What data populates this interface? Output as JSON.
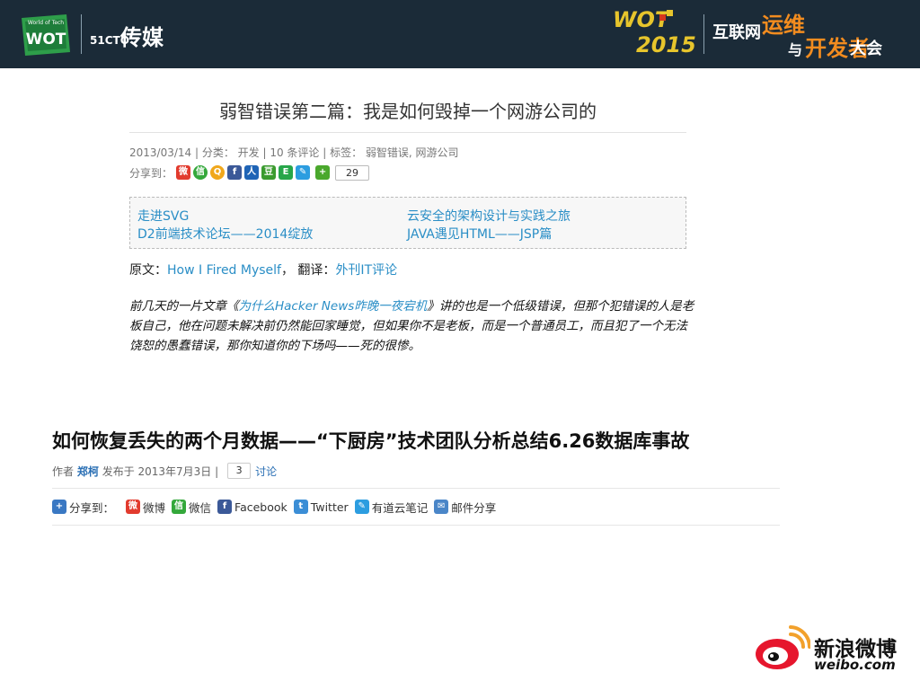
{
  "header": {
    "wot_logo_small": "World of Tech",
    "wot_logo_text": "WOT",
    "cto_brand": "51CTO",
    "media_brand": "传媒",
    "wot_line1": "WOT",
    "wot_line2": "2015",
    "conf_part1": "互联网",
    "conf_part2": "运维",
    "conf_part3": "与",
    "conf_part4": "开发者",
    "conf_part5": "大会"
  },
  "article1": {
    "title": "弱智错误第二篇：我是如何毁掉一个网游公司的",
    "meta": "2013/03/14 | 分类： 开发 | 10 条评论 | 标签： 弱智错误, 网游公司",
    "share_label": "分享到：",
    "share_count": "29",
    "related": [
      "走进SVG",
      "云安全的架构设计与实践之旅",
      "D2前端技术论坛——2014绽放",
      "JAVA遇见HTML——JSP篇"
    ],
    "source_label": "原文：",
    "source_link": "How I Fired Myself",
    "translate_label": "， 翻译：",
    "translate_link": "外刊IT评论",
    "intro_pre": "前几天的一片文章《",
    "intro_link": "为什么Hacker News昨晚一夜宕机",
    "intro_post": "》讲的也是一个低级错误，但那个犯错误的人是老板自己，他在问题未解决前仍然能回家睡觉，但如果你不是老板，而是一个普通员工，而且犯了一个无法饶恕的愚蠢错误，那你知道你的下场吗——死的很惨。"
  },
  "article2": {
    "title": "如何恢复丢失的两个月数据——“下厨房”技术团队分析总结6.26数据库事故",
    "author_label": "作者",
    "author": "郑柯",
    "published": "发布于 2013年7月3日 |",
    "comment_count": "3",
    "discuss": "讨论",
    "share_label": "分享到：",
    "share_items": [
      "微博",
      "微信",
      "Facebook",
      "Twitter",
      "有道云笔记",
      "邮件分享"
    ]
  },
  "footer": {
    "weibo_cn": "新浪微博",
    "weibo_en": "weibo.com"
  },
  "colors": {
    "topbar": "#1b2b38",
    "wot_yellow": "#e7c52c",
    "conf_orange": "#f28c1f",
    "link_blue": "#2a8ec6",
    "weibo_red": "#e6162d"
  }
}
